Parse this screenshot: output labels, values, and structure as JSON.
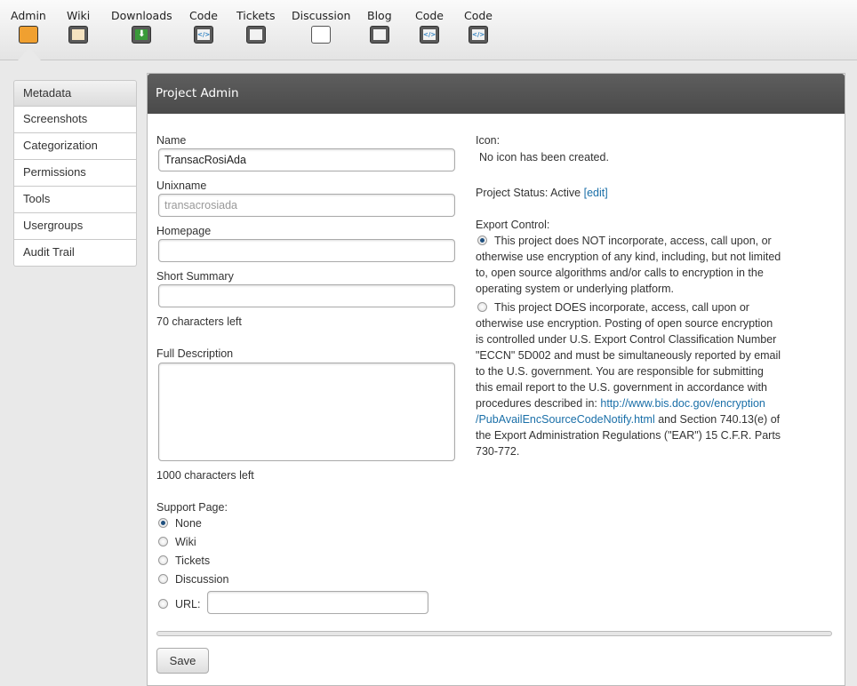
{
  "nav": {
    "tools": [
      {
        "label": "Admin",
        "icon": "admin-icon"
      },
      {
        "label": "Wiki",
        "icon": "wiki-icon"
      },
      {
        "label": "Downloads",
        "icon": "download-icon"
      },
      {
        "label": "Code",
        "icon": "code-icon"
      },
      {
        "label": "Tickets",
        "icon": "tickets-icon"
      },
      {
        "label": "Discussion",
        "icon": "discussion-icon"
      },
      {
        "label": "Blog",
        "icon": "blog-icon"
      },
      {
        "label": "Code",
        "icon": "code-icon"
      },
      {
        "label": "Code",
        "icon": "code-icon"
      }
    ]
  },
  "sidebar": {
    "items": [
      "Metadata",
      "Screenshots",
      "Categorization",
      "Permissions",
      "Tools",
      "Usergroups",
      "Audit Trail"
    ]
  },
  "panel": {
    "title": "Project Admin"
  },
  "form": {
    "name_label": "Name",
    "name_value": "TransacRosiAda",
    "unix_label": "Unixname",
    "unix_value": "transacrosiada",
    "home_label": "Homepage",
    "home_value": "",
    "summary_label": "Short Summary",
    "summary_value": "",
    "summary_left": "70 characters left",
    "desc_label": "Full Description",
    "desc_left": "1000 characters left",
    "support_label": "Support Page:",
    "support_options": [
      "None",
      "Wiki",
      "Tickets",
      "Discussion",
      "URL:"
    ],
    "support_selected": "None",
    "url_value": "",
    "save": "Save"
  },
  "right": {
    "icon_label": "Icon:",
    "icon_text": "No icon has been created.",
    "status_label": "Project Status: Active",
    "status_edit": "[edit]",
    "export_label": "Export Control:",
    "opt1": "This project does NOT incorporate, access, call upon, or otherwise use encryption of any kind, including, but not limited to, open source algorithms and/or calls to encryption in the operating system or underlying platform.",
    "opt2": "This project DOES incorporate, access, call upon or otherwise use encryption. Posting of open source encryption is controlled under U.S. Export Control Classification Number \"ECCN\" 5D002 and must be simultaneously reported by email to the U.S. government. You are responsible for submitting this email report to the U.S. government in accordance with procedures described in:",
    "link": "http://www.bis.doc.gov/encryption /PubAvailEncSourceCodeNotify.html",
    "opt2_tail": "and Section 740.13(e) of the Export Administration Regulations (\"EAR\") 15 C.F.R. Parts 730-772.",
    "selected": 1
  }
}
